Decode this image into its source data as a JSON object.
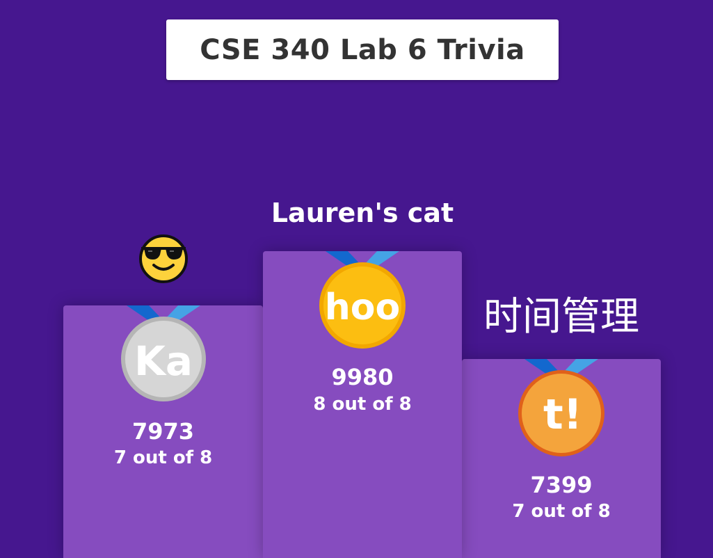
{
  "title": "CSE 340 Lab 6 Trivia",
  "podium": {
    "first": {
      "name": "Lauren's cat",
      "medal_text": "hoo",
      "medal_color": "#fcbe11",
      "medal_rim": "#f2a700",
      "score": "9980",
      "correct": "8 out of 8"
    },
    "second": {
      "avatar_icon": "sunglasses-smiley-icon",
      "medal_text": "Ka",
      "medal_color": "#d6d6d6",
      "medal_rim": "#b5b5b5",
      "score": "7973",
      "correct": "7 out of 8"
    },
    "third": {
      "name": "时间管理",
      "medal_text": "t!",
      "medal_color": "#f4a43c",
      "medal_rim": "#e0611a",
      "score": "7399",
      "correct": "7 out of 8"
    }
  },
  "colors": {
    "background": "#46178f",
    "podium": "#864cbf",
    "ribbon_dark": "#1368ce",
    "ribbon_light": "#45a3e5"
  }
}
